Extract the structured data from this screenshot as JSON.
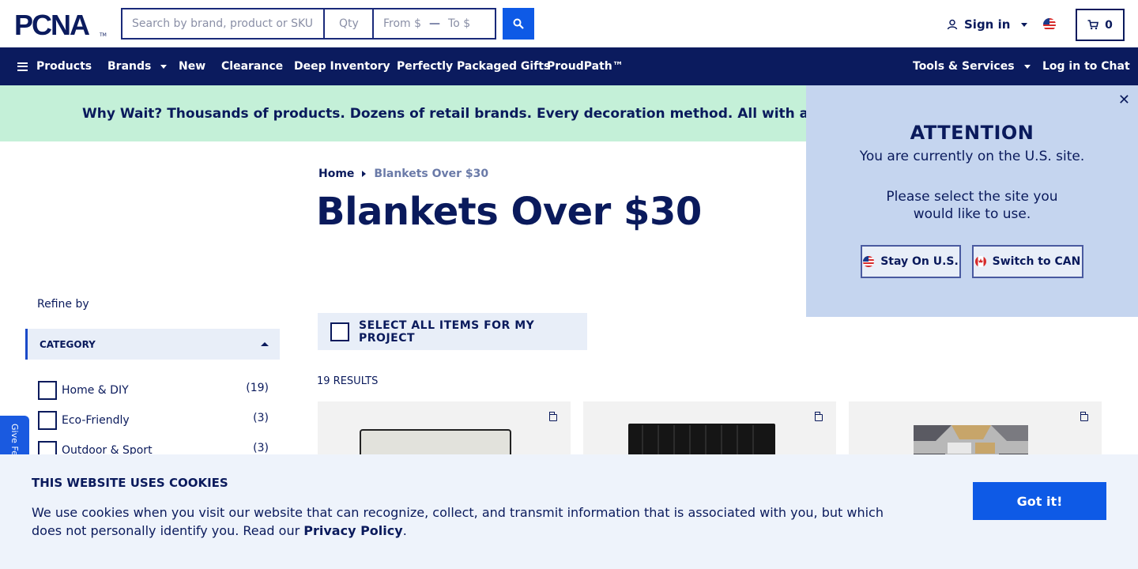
{
  "header": {
    "logo_text": "PCNA",
    "search": {
      "placeholder": "Search by brand, product or SKU",
      "qty_placeholder": "Qty",
      "from_placeholder": "From $",
      "to_placeholder": "To $"
    },
    "signin_label": "Sign in",
    "cart_count": "0"
  },
  "nav": {
    "products": "Products",
    "brands": "Brands",
    "new": "New",
    "clearance": "Clearance",
    "deep_inventory": "Deep Inventory",
    "gifts": "Perfectly Packaged Gifts",
    "proudpath": "ProudPath™",
    "tools": "Tools & Services",
    "chat": "Log in to Chat"
  },
  "promo": {
    "text": "Why Wait? Thousands of products. Dozens of retail brands. Every decoration method. All with a standard"
  },
  "breadcrumb": {
    "home": "Home",
    "current": "Blankets Over $30"
  },
  "page_title": "Blankets Over $30",
  "sidebar": {
    "refine_label": "Refine by",
    "category_label": "CATEGORY",
    "facets": [
      {
        "label": "Home & DIY",
        "count": "(19)"
      },
      {
        "label": "Eco-Friendly",
        "count": "(3)"
      },
      {
        "label": "Outdoor & Sport",
        "count": "(3)"
      }
    ],
    "feedback_label": "Give Feedback"
  },
  "results": {
    "select_all_label": "SELECT ALL ITEMS FOR MY PROJECT",
    "count_label": "19 RESULTS"
  },
  "attention": {
    "heading": "ATTENTION",
    "line1": "You are currently on the U.S. site.",
    "line2": "Please select the site you would like to use.",
    "stay_label": "Stay On U.S.",
    "switch_label": "Switch to CAN"
  },
  "cookie": {
    "heading": "THIS WEBSITE USES COOKIES",
    "text": "We use cookies when you visit our website that can recognize, collect, and transmit information that is associated with you, but which does not personally identify you. Read our ",
    "link": "Privacy Policy",
    "suffix": ".",
    "accept_label": "Got it!"
  },
  "colors": {
    "navy": "#0b1b5e",
    "accent_blue": "#0e5ae6",
    "promo_green": "#c4f0d8",
    "popup_blue": "#c5d5ef"
  },
  "icons": [
    "search-icon",
    "user-icon",
    "us-flag-icon",
    "cart-icon",
    "menu-icon",
    "close-icon",
    "canada-flag-icon",
    "save-to-project-icon"
  ]
}
